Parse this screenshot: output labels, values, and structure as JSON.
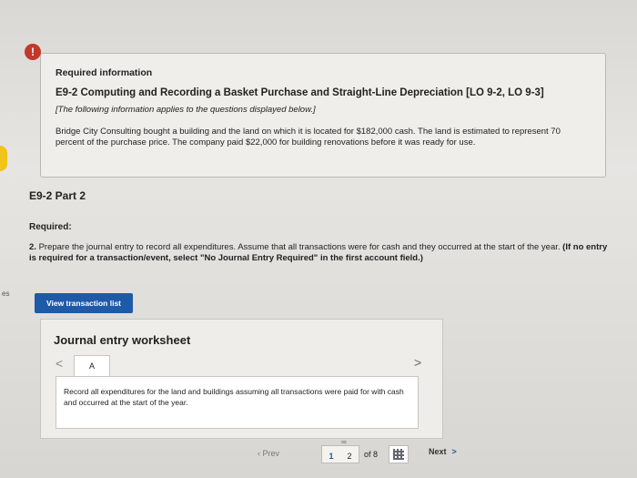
{
  "info_box": {
    "badge": "!",
    "header": "Required information",
    "exercise_title": "E9-2 Computing and Recording a Basket Purchase and Straight-Line Depreciation [LO 9-2, LO 9-3]",
    "note": "[The following information applies to the questions displayed below.]",
    "body": "Bridge City Consulting bought a building and the land on which it is located for $182,000 cash. The land is estimated to represent 70 percent of the purchase price. The company paid $22,000 for building renovations before it was ready for use."
  },
  "part": {
    "title": "E9-2 Part 2",
    "required_label": "Required:",
    "question_number": "2.",
    "question_text": "Prepare the journal entry to record all expenditures. Assume that all transactions were for cash and they occurred at the start of the year.",
    "instruction": "(If no entry is required for a transaction/event, select \"No Journal Entry Required\" in the first account field.)"
  },
  "left_margin_label": "es",
  "view_button_label": "View transaction list",
  "worksheet": {
    "title": "Journal entry worksheet",
    "prev_arrow": "<",
    "tab_label": "A",
    "next_arrow": ">",
    "record_text": "Record all expenditures for the land and buildings assuming all transactions were paid for with cash and occurred at the start of the year."
  },
  "pager": {
    "prev_label": "Prev",
    "current_page": "1",
    "next_page_num": "2",
    "of_label": "of 8",
    "next_label": "Next",
    "next_chevron": ">"
  }
}
